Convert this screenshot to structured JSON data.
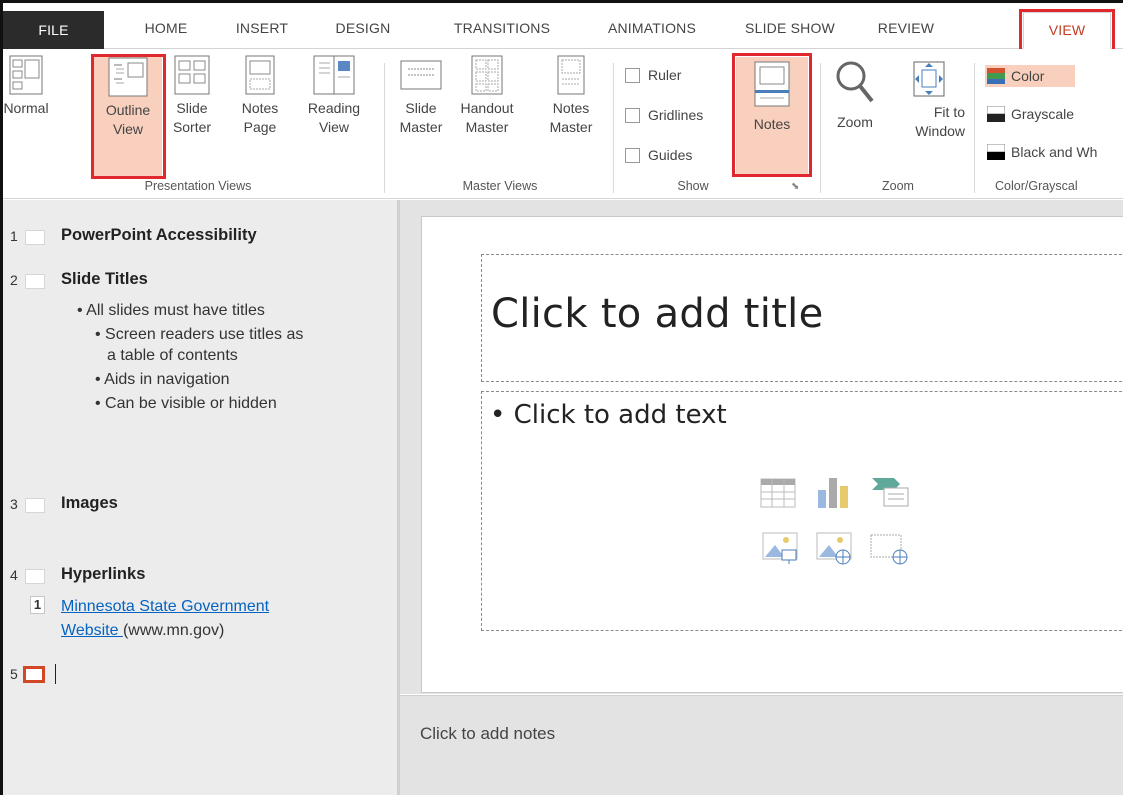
{
  "tabs": {
    "file": "FILE",
    "home": "HOME",
    "insert": "INSERT",
    "design": "DESIGN",
    "transitions": "TRANSITIONS",
    "animations": "ANIMATIONS",
    "slideshow": "SLIDE SHOW",
    "review": "REVIEW",
    "view": "VIEW"
  },
  "ribbon": {
    "presentation_views": {
      "label": "Presentation Views",
      "normal": "Normal",
      "outline": "Outline\nView",
      "sorter": "Slide\nSorter",
      "notes_page": "Notes\nPage",
      "reading": "Reading\nView"
    },
    "master_views": {
      "label": "Master Views",
      "slide_master": "Slide\nMaster",
      "handout_master": "Handout\nMaster",
      "notes_master": "Notes\nMaster"
    },
    "show": {
      "label": "Show",
      "ruler": "Ruler",
      "gridlines": "Gridlines",
      "guides": "Guides",
      "notes": "Notes"
    },
    "zoom": {
      "label": "Zoom",
      "zoom": "Zoom",
      "fit": "Fit to\nWindow"
    },
    "color_grayscale": {
      "label": "Color/Grayscal",
      "color": "Color",
      "grayscale": "Grayscale",
      "bw": "Black and Wh"
    }
  },
  "outline": {
    "slides": [
      {
        "num": "1",
        "title": "PowerPoint Accessibility"
      },
      {
        "num": "2",
        "title": "Slide Titles"
      },
      {
        "num": "3",
        "title": "Images"
      },
      {
        "num": "4",
        "title": "Hyperlinks"
      },
      {
        "num": "5",
        "title": ""
      }
    ],
    "slide2_bullets": [
      "• All slides must have titles",
      "• Screen readers use titles as",
      "a table of contents",
      "• Aids in navigation",
      "• Can be visible or hidden"
    ],
    "link_num": "1",
    "link_text_1": "Minnesota State Government",
    "link_text_2": "Website ",
    "link_suffix": "(www.mn.gov)"
  },
  "slide": {
    "title_placeholder": "Click to add title",
    "body_placeholder": "• Click to add text"
  },
  "notes_placeholder": "Click to add notes",
  "colors": {
    "accent_red": "#e0282e",
    "highlight": "#f8d0bd",
    "file_tab": "#2b2b2b",
    "outline_bg": "#ececec"
  }
}
